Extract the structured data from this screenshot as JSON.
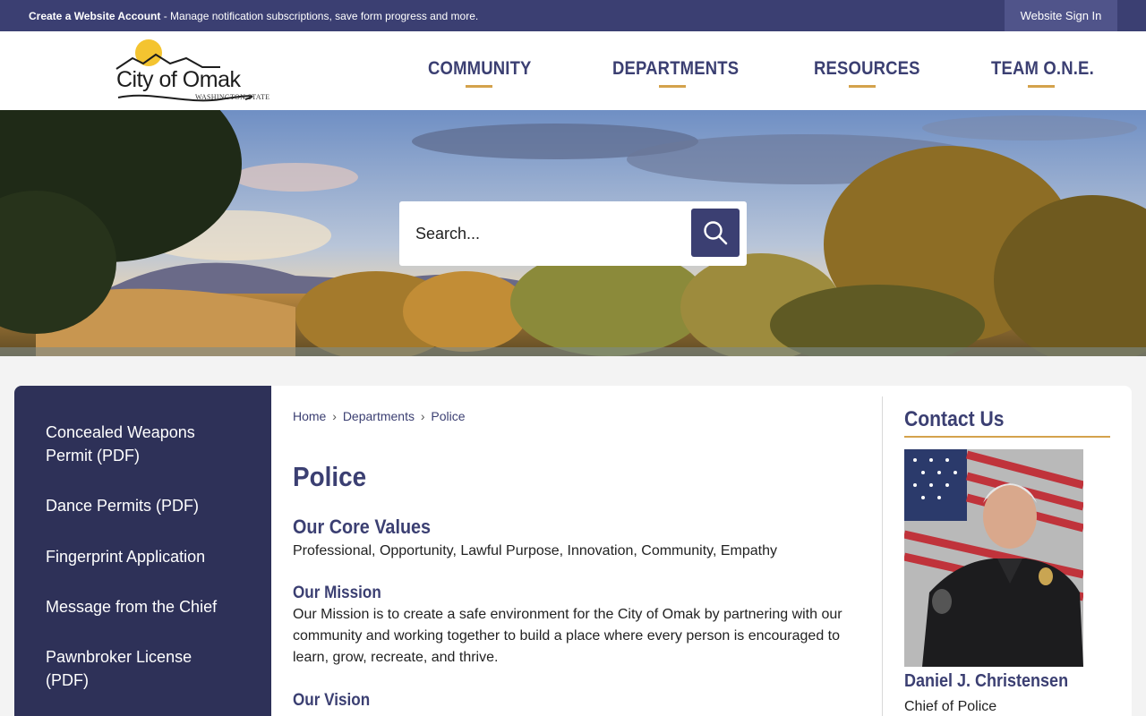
{
  "topbar": {
    "notice_bold": "Create a Website Account",
    "notice_rest": " - Manage notification subscriptions, save form progress and more.",
    "signin_label": "Website Sign In"
  },
  "logo": {
    "wordmark": "City of Omak",
    "state": "WASHINGTON STATE"
  },
  "nav": {
    "items": [
      {
        "label": "COMMUNITY"
      },
      {
        "label": "DEPARTMENTS"
      },
      {
        "label": "RESOURCES"
      },
      {
        "label": "TEAM O.N.E."
      }
    ]
  },
  "search": {
    "placeholder": "Search..."
  },
  "sidebar": {
    "items": [
      {
        "label": "Concealed Weapons Permit (PDF)"
      },
      {
        "label": "Dance Permits (PDF)"
      },
      {
        "label": "Fingerprint Application"
      },
      {
        "label": "Message from the Chief"
      },
      {
        "label": "Pawnbroker License (PDF)"
      }
    ]
  },
  "breadcrumb": {
    "items": [
      "Home",
      "Departments",
      "Police"
    ],
    "separator": "›"
  },
  "main": {
    "title": "Police",
    "core_values_heading": "Our Core Values",
    "core_values_text": "Professional, Opportunity, Lawful Purpose, Innovation, Community, Empathy",
    "mission_heading": "Our Mission",
    "mission_text": "Our Mission is to create a safe environment for the City of Omak by partnering with our community and working together to build a place where every person is encouraged to learn, grow, recreate, and thrive.",
    "vision_heading": "Our Vision"
  },
  "contact": {
    "title": "Contact Us",
    "name": "Daniel J. Christensen",
    "role": "Chief of Police"
  },
  "colors": {
    "brand_navy": "#3b3f72",
    "sidebar_navy": "#2e3158",
    "accent_gold": "#d4a24c"
  },
  "icons": {
    "search": "magnifier-icon"
  }
}
